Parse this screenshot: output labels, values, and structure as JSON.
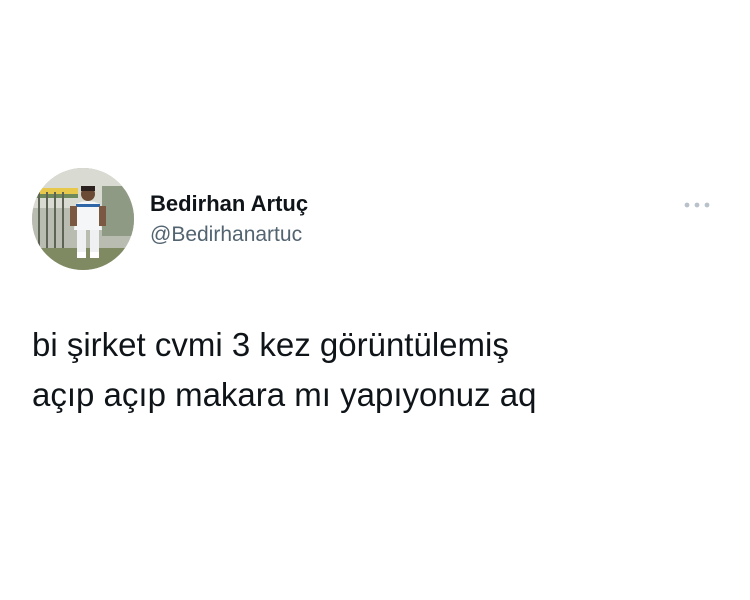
{
  "author": {
    "display_name": "Bedirhan Artuç",
    "handle": "@Bedirhanartuc",
    "avatar_icon": "profile-photo"
  },
  "menu": {
    "icon": "more-horizontal-icon"
  },
  "tweet": {
    "lines": [
      "bi şirket cvmi 3 kez görüntülemiş",
      "açıp açıp makara mı yapıyonuz aq"
    ]
  },
  "colors": {
    "background": "#ffffff",
    "text": "#0f1419",
    "secondary_text": "#536471",
    "menu_dots": "#b9c2ca"
  }
}
